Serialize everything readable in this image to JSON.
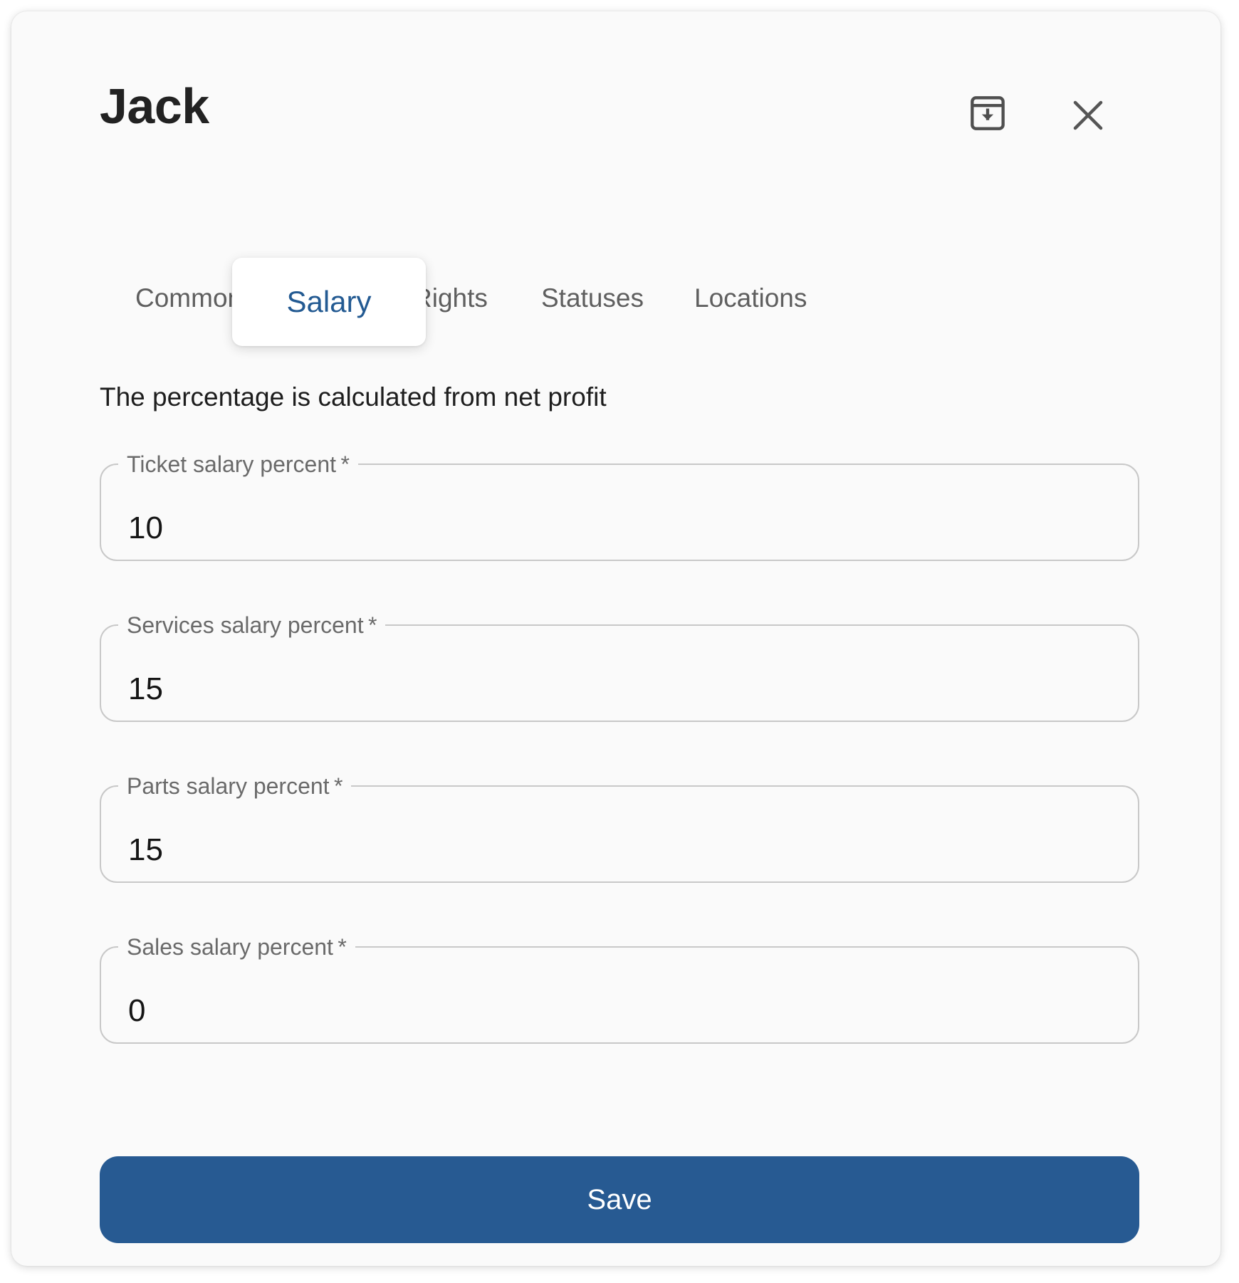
{
  "dialog": {
    "title": "Jack",
    "archive_icon": "archive-download-icon",
    "close_icon": "close-icon"
  },
  "tabs": [
    {
      "label": "Common",
      "active": false
    },
    {
      "label": "Salary",
      "active": true
    },
    {
      "label": "Rights",
      "active": false
    },
    {
      "label": "Statuses",
      "active": false
    },
    {
      "label": "Locations",
      "active": false
    }
  ],
  "hint": "The percentage is calculated from net profit",
  "fields": [
    {
      "label": "Ticket salary percent",
      "required_mark": "*",
      "value": "10"
    },
    {
      "label": "Services salary percent",
      "required_mark": "*",
      "value": "15"
    },
    {
      "label": "Parts salary percent",
      "required_mark": "*",
      "value": "15"
    },
    {
      "label": "Sales salary percent",
      "required_mark": "*",
      "value": "0"
    }
  ],
  "save_label": "Save",
  "colors": {
    "accent": "#275a92",
    "active_tab_text": "#235a92",
    "background": "#fafafa",
    "field_border": "#c8c8c8"
  }
}
